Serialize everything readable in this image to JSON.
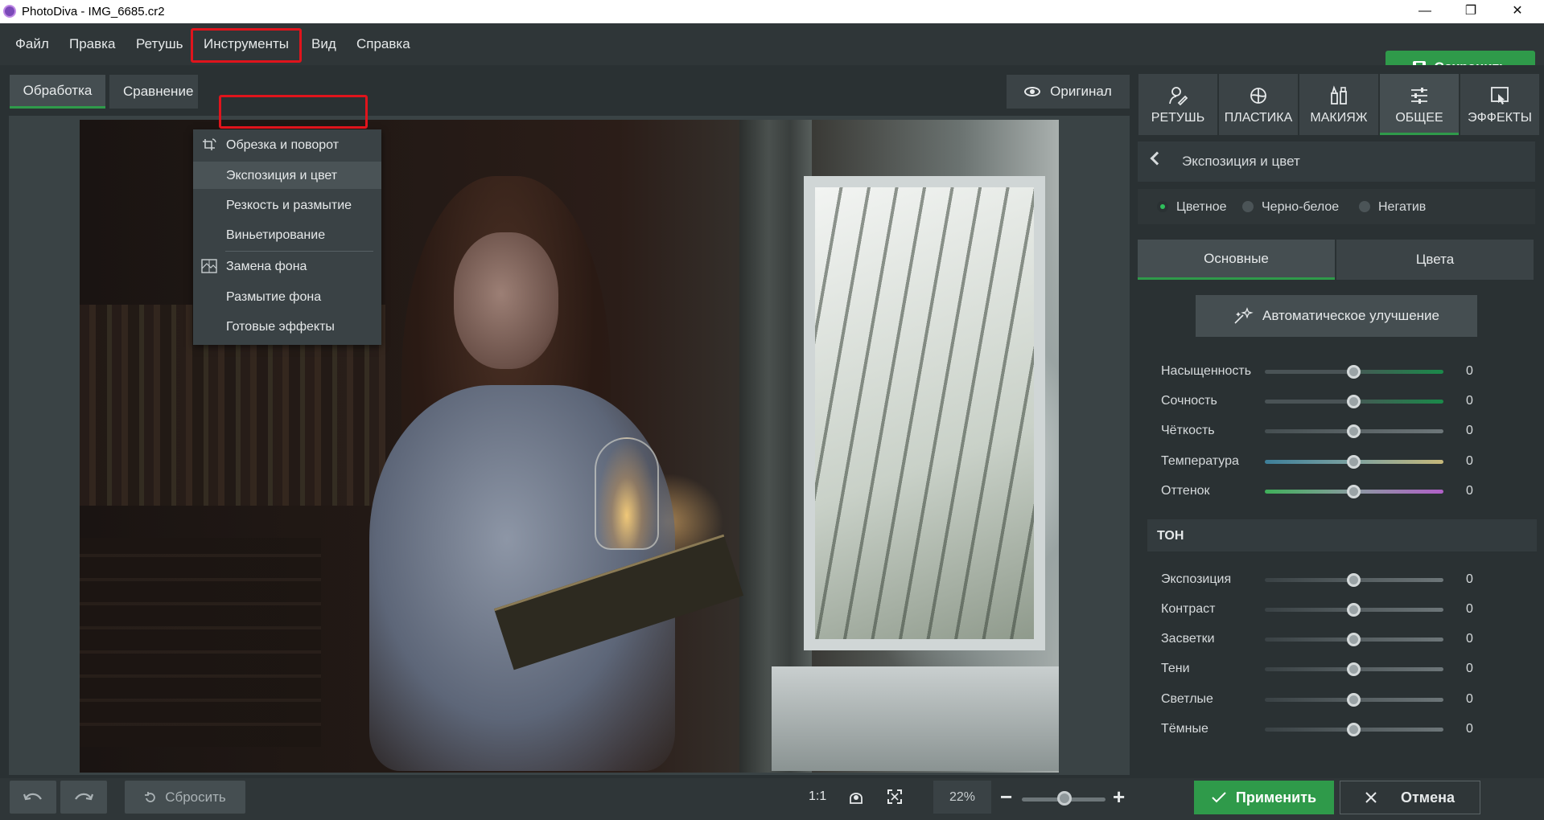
{
  "window": {
    "title": "PhotoDiva - IMG_6685.cr2",
    "minimize_glyph": "—",
    "restore_glyph": "❐",
    "close_glyph": "✕"
  },
  "menubar": {
    "items": [
      "Файл",
      "Правка",
      "Ретушь",
      "Инструменты",
      "Вид",
      "Справка"
    ],
    "active_item": "Инструменты",
    "save_label": "Сохранить"
  },
  "view_tabs": {
    "processing": "Обработка",
    "compare": "Сравнение",
    "original": "Оригинал"
  },
  "tools_menu": {
    "items": [
      {
        "label": "Обрезка и поворот",
        "icon": "crop-rotate-icon"
      },
      {
        "label": "Экспозиция и цвет",
        "icon": ""
      },
      {
        "label": "Резкость и размытие",
        "icon": ""
      },
      {
        "label": "Виньетирование",
        "icon": ""
      },
      {
        "label": "Замена фона",
        "icon": "background-replace-icon"
      },
      {
        "label": "Размытие фона",
        "icon": ""
      },
      {
        "label": "Готовые эффекты",
        "icon": ""
      }
    ],
    "selected": "Экспозиция и цвет"
  },
  "bottombar": {
    "reset_label": "Сбросить",
    "one_to_one": "1:1",
    "zoom_value": "22%",
    "zoom_slider_fraction": 0.42,
    "apply_label": "Применить",
    "cancel_label": "Отмена"
  },
  "right_panel": {
    "tabs": [
      {
        "label": "РЕТУШЬ",
        "icon": "retouch-icon"
      },
      {
        "label": "ПЛАСТИКА",
        "icon": "plastic-icon"
      },
      {
        "label": "МАКИЯЖ",
        "icon": "makeup-icon"
      },
      {
        "label": "ОБЩЕЕ",
        "icon": "general-sliders-icon"
      },
      {
        "label": "ЭФФЕКТЫ",
        "icon": "effects-icon"
      }
    ],
    "active_tab": "ОБЩЕЕ",
    "section_title": "Экспозиция и цвет",
    "modes": [
      "Цветное",
      "Черно-белое",
      "Негатив"
    ],
    "selected_mode": "Цветное",
    "sub_tabs": [
      "Основные",
      "Цвета"
    ],
    "active_sub_tab": "Основные",
    "auto_button": "Автоматическое улучшение",
    "color_sliders": [
      {
        "label": "Насыщенность",
        "value": "0"
      },
      {
        "label": "Сочность",
        "value": "0"
      },
      {
        "label": "Чёткость",
        "value": "0"
      },
      {
        "label": "Температура",
        "value": "0"
      },
      {
        "label": "Оттенок",
        "value": "0"
      }
    ],
    "tone_header": "ТОН",
    "tone_sliders": [
      {
        "label": "Экспозиция",
        "value": "0"
      },
      {
        "label": "Контраст",
        "value": "0"
      },
      {
        "label": "Засветки",
        "value": "0"
      },
      {
        "label": "Тени",
        "value": "0"
      },
      {
        "label": "Светлые",
        "value": "0"
      },
      {
        "label": "Тёмные",
        "value": "0"
      }
    ]
  },
  "colors": {
    "accent_green": "#2f9a4a",
    "highlight_red": "#e0141c",
    "panel_bg": "#2a3133"
  }
}
